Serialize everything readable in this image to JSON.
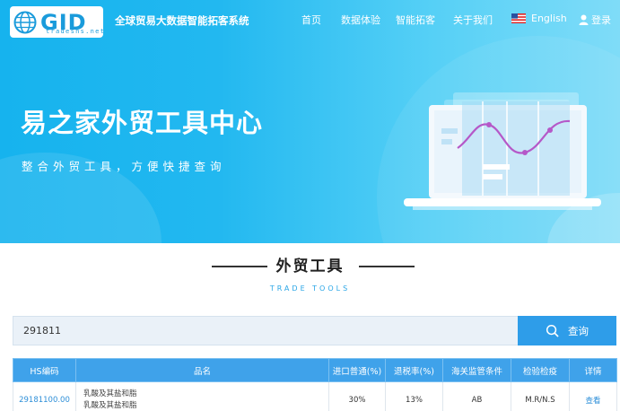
{
  "header": {
    "logo_text": "GID",
    "logo_domain": "tradesns.net",
    "site_name": "全球贸易大数据智能拓客系统",
    "nav": {
      "home": "首页",
      "data_trial": "数据体验",
      "ai_prospecting": "智能拓客",
      "about": "关于我们",
      "language": "English",
      "login": "登录"
    }
  },
  "hero": {
    "title": "易之家外贸工具中心",
    "subtitle": "整合外贸工具，方便快捷查询"
  },
  "section": {
    "title": "外贸工具",
    "subtitle_en": "TRADE TOOLS"
  },
  "search": {
    "value": "291811",
    "button_label": "查询"
  },
  "table": {
    "headers": [
      "HS编码",
      "品名",
      "进口普通(%)",
      "退税率(%)",
      "海关监管条件",
      "检验检疫",
      "详情"
    ],
    "rows": [
      {
        "hs_code": "29181100.00",
        "name_line1": "乳酸及其盐和脂",
        "name_line2": "乳酸及其盐和脂",
        "import_general": "30%",
        "rebate_rate": "13%",
        "customs_condition": "AB",
        "inspection": "M.R/N.S",
        "detail": "查看"
      }
    ]
  }
}
